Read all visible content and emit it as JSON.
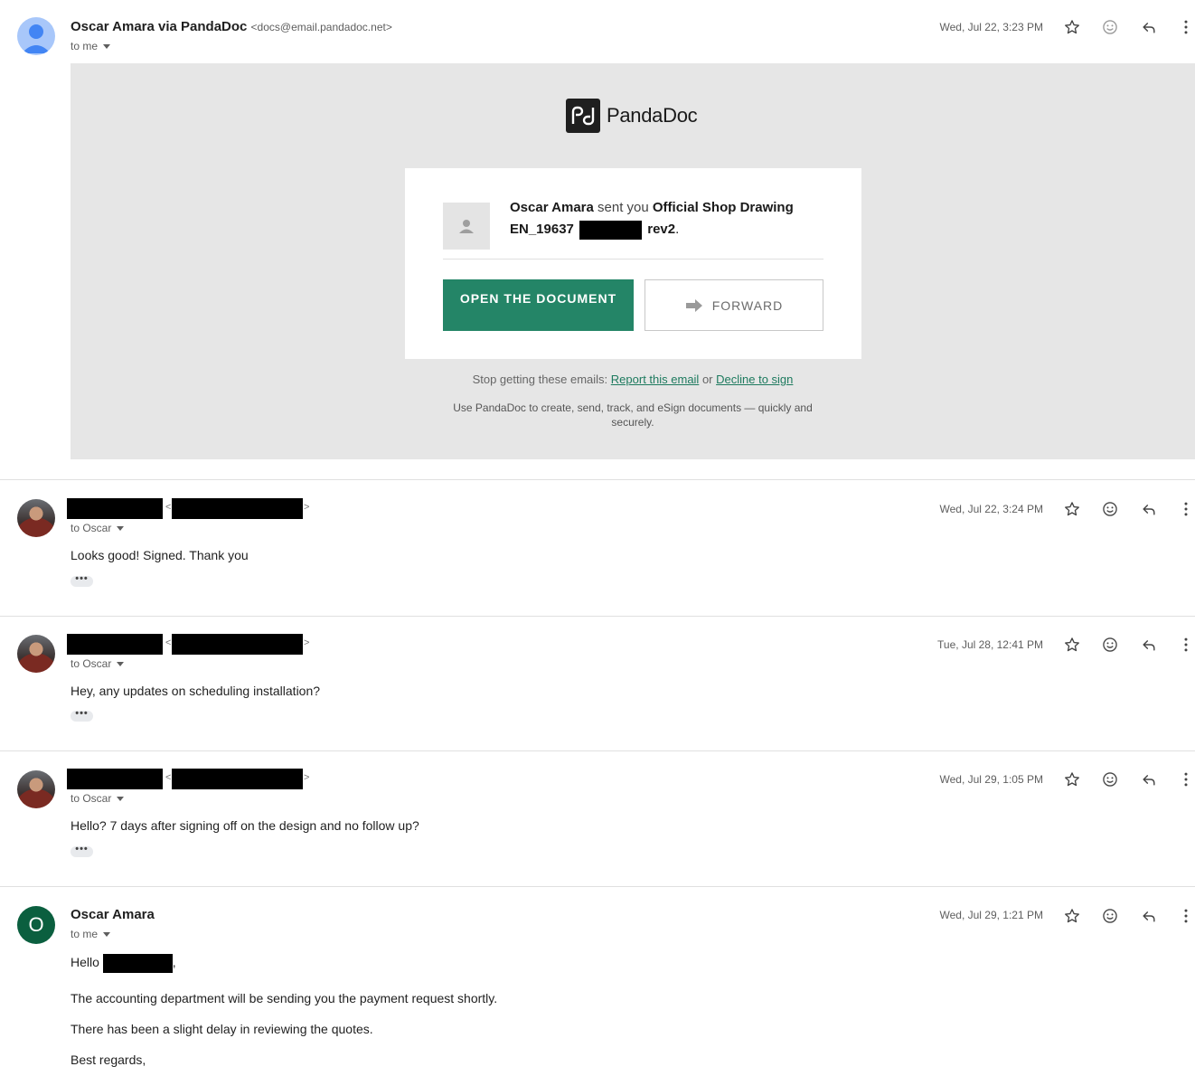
{
  "messages": [
    {
      "sender": "Oscar Amara via PandaDoc",
      "sender_email": "<docs@email.pandadoc.net>",
      "to": "to me",
      "date": "Wed, Jul 22, 3:23 PM"
    },
    {
      "to": "to Oscar",
      "date": "Wed, Jul 22, 3:24 PM",
      "body": "Looks good! Signed. Thank you",
      "dots": "•••"
    },
    {
      "to": "to Oscar",
      "date": "Tue, Jul 28, 12:41 PM",
      "body": "Hey, any updates on scheduling installation?",
      "dots": "•••"
    },
    {
      "to": "to Oscar",
      "date": "Wed, Jul 29, 1:05 PM",
      "body": "Hello? 7 days after signing off on the design and no follow up?",
      "dots": "•••"
    },
    {
      "sender": "Oscar Amara",
      "avatar_letter": "O",
      "to": "to me",
      "date": "Wed, Jul 29, 1:21 PM",
      "greeting": "Hello",
      "greeting_end": ",",
      "lines": [
        "The accounting department will be sending you the payment request shortly.",
        "There has been a slight delay in reviewing the quotes.",
        "Best regards,"
      ]
    }
  ],
  "pandadoc": {
    "brand": "PandaDoc",
    "sender_name": "Oscar Amara",
    "sent_you": " sent you ",
    "doc_title_1": "Official Shop Drawing",
    "doc_title_2a": "EN_19637",
    "doc_title_2b": "rev2",
    "period": ".",
    "open_button": "OPEN THE DOCUMENT",
    "forward_button": "FORWARD",
    "stop_text": "Stop getting these emails: ",
    "report_link": "Report this email",
    "or": " or ",
    "decline_link": "Decline to sign",
    "footer": "Use PandaDoc to create, send, track, and eSign documents — quickly and securely."
  },
  "icons": {
    "star": "star-icon",
    "emoji": "emoji-icon",
    "reply": "reply-icon",
    "more": "more-vert-icon"
  },
  "colors": {
    "pandadoc_green": "#248567",
    "link_green": "#1d7a5e",
    "avatar_dark_green": "#0b5f3f"
  }
}
